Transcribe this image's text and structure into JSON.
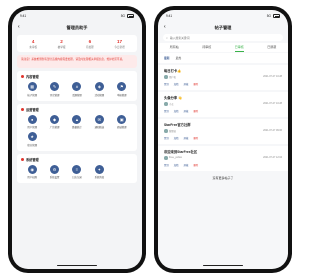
{
  "left": {
    "status": {
      "time": "9:41",
      "signal": "5G"
    },
    "title": "管理员助手",
    "stats": [
      {
        "value": "4",
        "label": "未审核"
      },
      {
        "value": "2",
        "label": "被举报"
      },
      {
        "value": "6",
        "label": "待处理"
      },
      {
        "value": "17",
        "label": "今日新增"
      }
    ],
    "alert": "请注意！系统检测到有部分违规内容需要处理，请及时处理相关举报信息，维护社区环境。",
    "sections": [
      {
        "title": "内容管理",
        "items": [
          {
            "label": "帖子管理",
            "icon": "post-icon",
            "glyph": "▦"
          },
          {
            "label": "评论管理",
            "icon": "comment-icon",
            "glyph": "✎"
          },
          {
            "label": "话题管理",
            "icon": "topic-icon",
            "glyph": "#"
          },
          {
            "label": "活动管理",
            "icon": "activity-icon",
            "glyph": "◈"
          },
          {
            "label": "举报管理",
            "icon": "report-icon",
            "glyph": "⚑"
          }
        ]
      },
      {
        "title": "运营管理",
        "items": [
          {
            "label": "用户管理",
            "icon": "user-icon",
            "glyph": "●"
          },
          {
            "label": "广告管理",
            "icon": "ad-icon",
            "glyph": "◆"
          },
          {
            "label": "数据统计",
            "icon": "stats-icon",
            "glyph": "▲"
          },
          {
            "label": "通知推送",
            "icon": "notify-icon",
            "glyph": "✉"
          },
          {
            "label": "商城管理",
            "icon": "store-icon",
            "glyph": "▣"
          },
          {
            "label": "积分管理",
            "icon": "points-icon",
            "glyph": "★"
          }
        ]
      },
      {
        "title": "系统管理",
        "items": [
          {
            "label": "用户权限",
            "icon": "permission-icon",
            "glyph": "◉"
          },
          {
            "label": "系统设置",
            "icon": "settings-icon",
            "glyph": "⚙"
          },
          {
            "label": "日志记录",
            "icon": "log-icon",
            "glyph": "≡"
          },
          {
            "label": "系统消息",
            "icon": "message-icon",
            "glyph": "✦"
          }
        ]
      }
    ]
  },
  "right": {
    "status": {
      "time": "9:41",
      "signal": "5G"
    },
    "title": "帖子管理",
    "search_placeholder": "输入搜索关键词",
    "tabs": [
      "所有帖",
      "待审核",
      "已审核",
      "已屏蔽"
    ],
    "active_tab": 2,
    "subtabs": [
      "最新",
      "最热"
    ],
    "active_subtab": 0,
    "posts": [
      {
        "title": "每日打卡👍",
        "author": "用户名",
        "time": "2021-07-27 10:28",
        "actions": [
          "置顶",
          "加精",
          "屏蔽",
          "删除"
        ]
      },
      {
        "title": "头像分享 👋",
        "author": "小王",
        "time": "2021-07-27 10:28",
        "actions": [
          "置顶",
          "加精",
          "屏蔽",
          "删除"
        ]
      },
      {
        "title": "StarFree官方社群",
        "author": "管理员",
        "time": "2021-07-27 09:06",
        "actions": [
          "置顶",
          "加精",
          "屏蔽",
          "删除"
        ]
      },
      {
        "title": "欢迎来到StarFree社区",
        "author": "Free_yellow",
        "time": "2021-07-27 12:04",
        "actions": [
          "置顶",
          "加精",
          "屏蔽",
          "删除"
        ]
      }
    ],
    "footer": "没有更多帖子了"
  },
  "colors": {
    "accent_red": "#e0342d",
    "accent_blue": "#3f5f96",
    "accent_green": "#3ab24a"
  }
}
